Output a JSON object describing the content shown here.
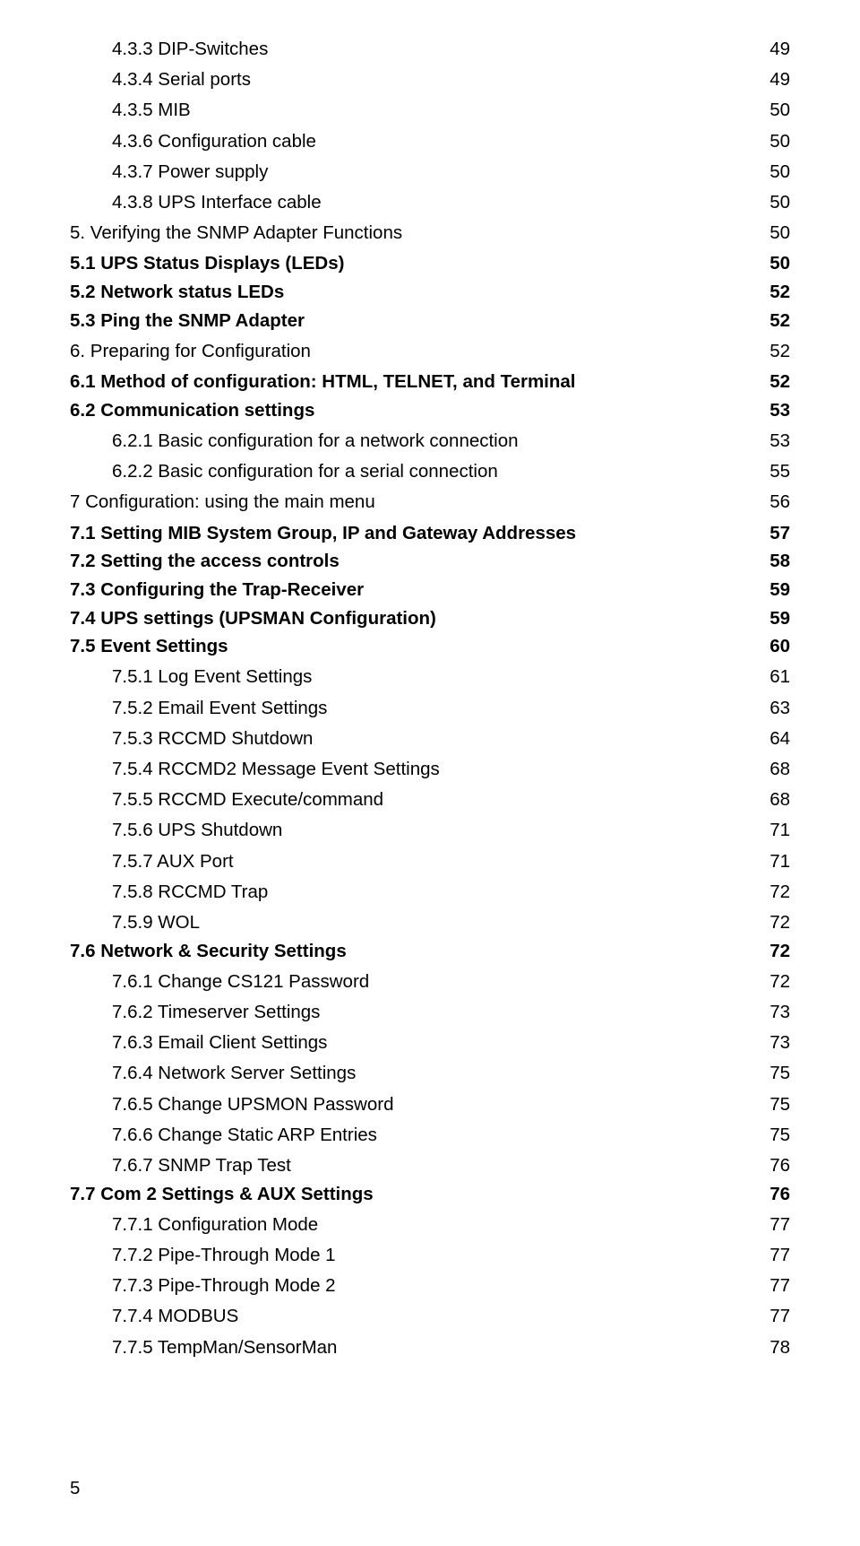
{
  "toc": [
    {
      "label": "4.3.3 DIP-Switches",
      "page": "49",
      "indent": 2,
      "bold": false,
      "gap": false
    },
    {
      "label": "4.3.4 Serial ports",
      "page": "49",
      "indent": 2,
      "bold": false,
      "gap": true
    },
    {
      "label": "4.3.5 MIB",
      "page": "50",
      "indent": 2,
      "bold": false,
      "gap": true
    },
    {
      "label": "4.3.6 Configuration cable",
      "page": "50",
      "indent": 2,
      "bold": false,
      "gap": true
    },
    {
      "label": "4.3.7 Power supply",
      "page": "50",
      "indent": 2,
      "bold": false,
      "gap": true
    },
    {
      "label": "4.3.8 UPS Interface cable",
      "page": "50",
      "indent": 2,
      "bold": false,
      "gap": true
    },
    {
      "label": "5. Verifying the SNMP Adapter Functions",
      "page": "50",
      "indent": 0,
      "bold": false,
      "gap": true
    },
    {
      "label": "5.1 UPS Status Displays (LEDs)",
      "page": "50",
      "indent": 0,
      "bold": true,
      "gap": true
    },
    {
      "label": "5.2 Network status LEDs",
      "page": "52",
      "indent": 0,
      "bold": true,
      "gap": false
    },
    {
      "label": "5.3 Ping the SNMP Adapter",
      "page": "52",
      "indent": 0,
      "bold": true,
      "gap": false
    },
    {
      "label": "6. Preparing for Configuration",
      "page": "52",
      "indent": 0,
      "bold": false,
      "gap": true
    },
    {
      "label": "6.1 Method of configuration: HTML, TELNET, and Terminal",
      "page": "52",
      "indent": 0,
      "bold": true,
      "gap": true
    },
    {
      "label": "6.2 Communication settings",
      "page": "53",
      "indent": 0,
      "bold": true,
      "gap": false
    },
    {
      "label": "6.2.1 Basic configuration for a network connection",
      "page": "53",
      "indent": 2,
      "bold": false,
      "gap": true
    },
    {
      "label": "6.2.2 Basic configuration for a serial connection",
      "page": "55",
      "indent": 2,
      "bold": false,
      "gap": true
    },
    {
      "label": "7 Configuration: using the main menu",
      "page": "56",
      "indent": 0,
      "bold": false,
      "gap": true
    },
    {
      "label": "7.1 Setting MIB System Group, IP and Gateway Addresses",
      "page": "57",
      "indent": 0,
      "bold": true,
      "gap": true
    },
    {
      "label": "7.2 Setting the access controls",
      "page": "58",
      "indent": 0,
      "bold": true,
      "gap": false
    },
    {
      "label": "7.3 Configuring the Trap-Receiver",
      "page": "59",
      "indent": 0,
      "bold": true,
      "gap": false
    },
    {
      "label": "7.4 UPS settings (UPSMAN Configuration)",
      "page": "59",
      "indent": 0,
      "bold": true,
      "gap": false
    },
    {
      "label": "7.5 Event Settings",
      "page": "60",
      "indent": 0,
      "bold": true,
      "gap": false
    },
    {
      "label": "7.5.1 Log Event Settings",
      "page": "61",
      "indent": 2,
      "bold": false,
      "gap": true
    },
    {
      "label": "7.5.2 Email Event Settings",
      "page": "63",
      "indent": 2,
      "bold": false,
      "gap": true
    },
    {
      "label": "7.5.3 RCCMD Shutdown",
      "page": "64",
      "indent": 2,
      "bold": false,
      "gap": true
    },
    {
      "label": "7.5.4 RCCMD2 Message Event Settings",
      "page": "68",
      "indent": 2,
      "bold": false,
      "gap": true
    },
    {
      "label": "7.5.5 RCCMD Execute/command",
      "page": "68",
      "indent": 2,
      "bold": false,
      "gap": true
    },
    {
      "label": "7.5.6 UPS Shutdown",
      "page": "71",
      "indent": 2,
      "bold": false,
      "gap": true
    },
    {
      "label": "7.5.7 AUX Port",
      "page": "71",
      "indent": 2,
      "bold": false,
      "gap": true
    },
    {
      "label": "7.5.8 RCCMD Trap",
      "page": "72",
      "indent": 2,
      "bold": false,
      "gap": true
    },
    {
      "label": "7.5.9 WOL",
      "page": "72",
      "indent": 2,
      "bold": false,
      "gap": true
    },
    {
      "label": "7.6 Network & Security Settings",
      "page": "72",
      "indent": 0,
      "bold": true,
      "gap": false
    },
    {
      "label": "7.6.1 Change CS121 Password",
      "page": "72",
      "indent": 2,
      "bold": false,
      "gap": true
    },
    {
      "label": "7.6.2 Timeserver Settings",
      "page": "73",
      "indent": 2,
      "bold": false,
      "gap": true
    },
    {
      "label": "7.6.3 Email Client Settings",
      "page": "73",
      "indent": 2,
      "bold": false,
      "gap": true
    },
    {
      "label": "7.6.4 Network Server Settings",
      "page": "75",
      "indent": 2,
      "bold": false,
      "gap": true
    },
    {
      "label": "7.6.5 Change UPSMON Password",
      "page": "75",
      "indent": 2,
      "bold": false,
      "gap": true
    },
    {
      "label": "7.6.6 Change Static ARP Entries",
      "page": "75",
      "indent": 2,
      "bold": false,
      "gap": true
    },
    {
      "label": "7.6.7 SNMP Trap Test",
      "page": "76",
      "indent": 2,
      "bold": false,
      "gap": true
    },
    {
      "label": "7.7 Com 2 Settings & AUX Settings",
      "page": "76",
      "indent": 0,
      "bold": true,
      "gap": false
    },
    {
      "label": "7.7.1 Configuration Mode",
      "page": "77",
      "indent": 2,
      "bold": false,
      "gap": true
    },
    {
      "label": "7.7.2 Pipe-Through Mode 1",
      "page": "77",
      "indent": 2,
      "bold": false,
      "gap": true
    },
    {
      "label": "7.7.3 Pipe-Through Mode 2",
      "page": "77",
      "indent": 2,
      "bold": false,
      "gap": true
    },
    {
      "label": "7.7.4 MODBUS",
      "page": "77",
      "indent": 2,
      "bold": false,
      "gap": true
    },
    {
      "label": "7.7.5 TempMan/SensorMan",
      "page": "78",
      "indent": 2,
      "bold": false,
      "gap": true
    }
  ],
  "footer_page": "5"
}
